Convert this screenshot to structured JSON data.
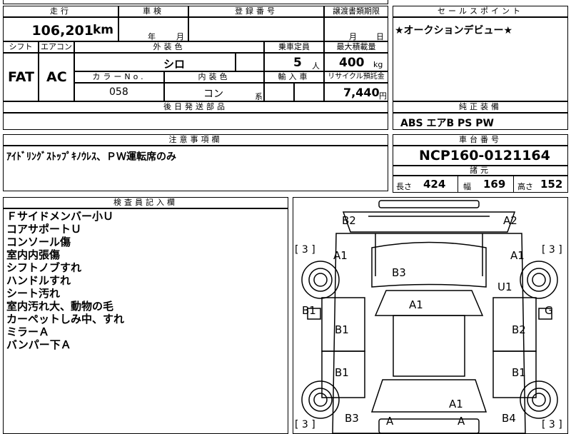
{
  "top_fragment": "",
  "mileage": {
    "label": "走行",
    "value": "106,201",
    "unit": "km"
  },
  "inspection": {
    "label": "車検",
    "year": "年",
    "month": "月"
  },
  "registration": {
    "label": "登録番号",
    "value": ""
  },
  "transfer_deadline": {
    "label": "譲渡書類期限",
    "month": "月",
    "day": "日"
  },
  "sales_point": {
    "label": "セールスポイント",
    "text": "★オークションデビュー★"
  },
  "shift": {
    "label": "シフト",
    "value": "FAT"
  },
  "aircon": {
    "label": "エアコン",
    "value": "AC"
  },
  "exterior_color": {
    "label": "外装色",
    "value": "シロ"
  },
  "capacity": {
    "label": "乗車定員",
    "value": "5",
    "unit": "人"
  },
  "max_load": {
    "label": "最大積載量",
    "value": "400",
    "unit": "kg"
  },
  "color_no": {
    "label": "カラーNo.",
    "value": "058"
  },
  "interior_color": {
    "label": "内装色",
    "value": "コン",
    "suffix": "系"
  },
  "import": {
    "label": "輸入車",
    "value": ""
  },
  "recycle": {
    "label": "リサイクル預託金",
    "value": "7,440",
    "unit": "円"
  },
  "deferred_parts": {
    "label": "後日発送部品",
    "value": ""
  },
  "genuine_equipment": {
    "label": "純正装備",
    "value": "ABS エアB PS PW"
  },
  "notes": {
    "label": "注意事項欄",
    "text": "ｱｲﾄﾞﾘﾝｸﾞｽﾄｯﾌﾟｷﾉｳﾚｽ、ＰＷ運転席のみ"
  },
  "chassis": {
    "label": "車台番号",
    "value": "NCP160-0121164"
  },
  "specs": {
    "label": "諸元",
    "length_label": "長さ",
    "length": "424",
    "width_label": "幅",
    "width": "169",
    "height_label": "高さ",
    "height": "152"
  },
  "inspector": {
    "label": "検査員記入欄",
    "lines": [
      "Ｆサイドメンバー小Ｕ",
      "コアサポートＵ",
      "コンソール傷",
      "室内内張傷",
      "シフトノブすれ",
      "ハンドルすれ",
      "シート汚れ",
      "室内汚れ大、動物の毛",
      "カーペットしみ中、すれ",
      "ミラーＡ",
      "バンパー下Ａ"
    ]
  },
  "diagram": {
    "marks": [
      "B2",
      "A2",
      "A1",
      "A1",
      "B3",
      "U1",
      "B1",
      "A1",
      "G",
      "B1",
      "B2",
      "B1",
      "B1",
      "A1",
      "B3",
      "B4",
      "A",
      "A"
    ],
    "tire_marks": [
      "[ 3 ]",
      "[ 3 ]",
      "[ 3 ]",
      "[ 3 ]"
    ]
  }
}
